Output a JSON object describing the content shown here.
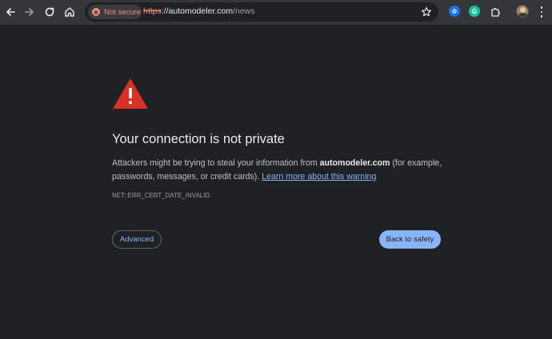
{
  "browser": {
    "security_chip": "Not secure",
    "url": {
      "scheme": "https",
      "separator": "://",
      "host": "automodeler.com",
      "path": "/news"
    },
    "toolbar_icons": [
      "back-arrow-icon",
      "forward-arrow-icon",
      "reload-icon",
      "home-icon",
      "star-icon",
      "extension-blue-icon",
      "grammarly-icon",
      "puzzle-extensions-icon",
      "profile-avatar",
      "kebab-menu-icon"
    ],
    "extensions": {
      "grammarly_letter": "G"
    }
  },
  "page": {
    "title": "Your connection is not private",
    "message_prefix": "Attackers might be trying to steal your information from ",
    "domain": "automodeler.com",
    "message_suffix": " (for example, passwords, messages, or credit cards). ",
    "learn_more_link": "Learn more about this warning",
    "error_code": "NET::ERR_CERT_DATE_INVALID",
    "advanced_button": "Advanced",
    "back_button": "Back to safety"
  },
  "colors": {
    "background": "#202124",
    "toolbar": "#35363a",
    "warning_red": "#d93025",
    "link_blue": "#8ab4f8",
    "not_secure_red": "#f28b82"
  }
}
